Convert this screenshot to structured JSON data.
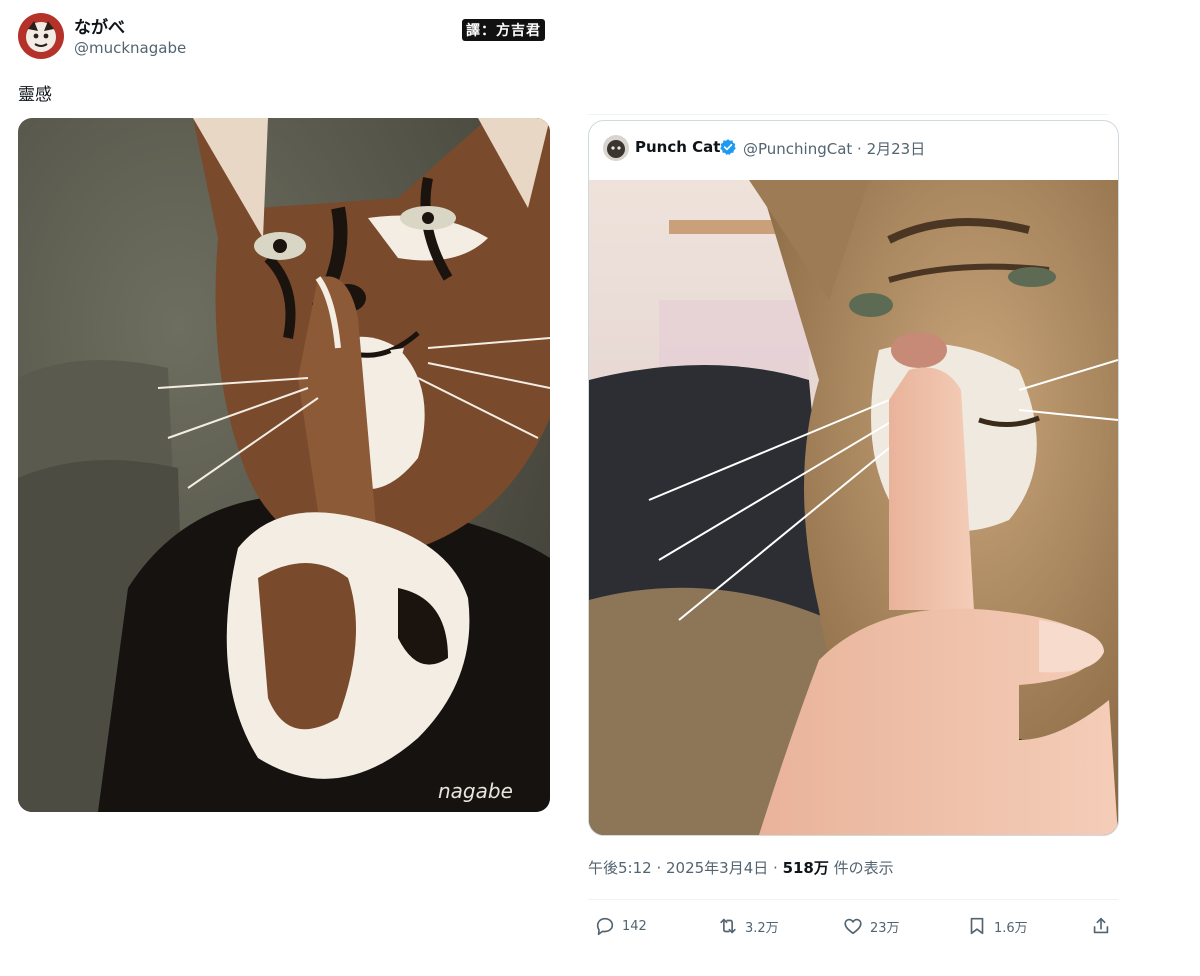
{
  "author": {
    "display_name": "ながべ",
    "handle": "@mucknagabe"
  },
  "translator_tag": "譯：方吉君",
  "tweet_text": "靈感",
  "illustration": {
    "signature": "nagabe",
    "image_icon": "cat-illustration-image"
  },
  "quote": {
    "display_name": "Punch Cat",
    "handle_date": "@PunchingCat · 2月23日",
    "verified_icon": "verified-badge-icon",
    "image_icon": "cat-photo-image"
  },
  "meta": {
    "time_date": "午後5:12 · 2025年3月4日 · ",
    "views": "518万",
    "views_label": " 件の表示"
  },
  "actions": {
    "reply_count": "142",
    "retweet_count": "3.2万",
    "like_count": "23万",
    "bookmark_count": "1.6万"
  },
  "colors": {
    "text_primary": "#0f1419",
    "text_secondary": "#536471",
    "verified": "#1d9bf0",
    "border": "#cfd9de"
  }
}
